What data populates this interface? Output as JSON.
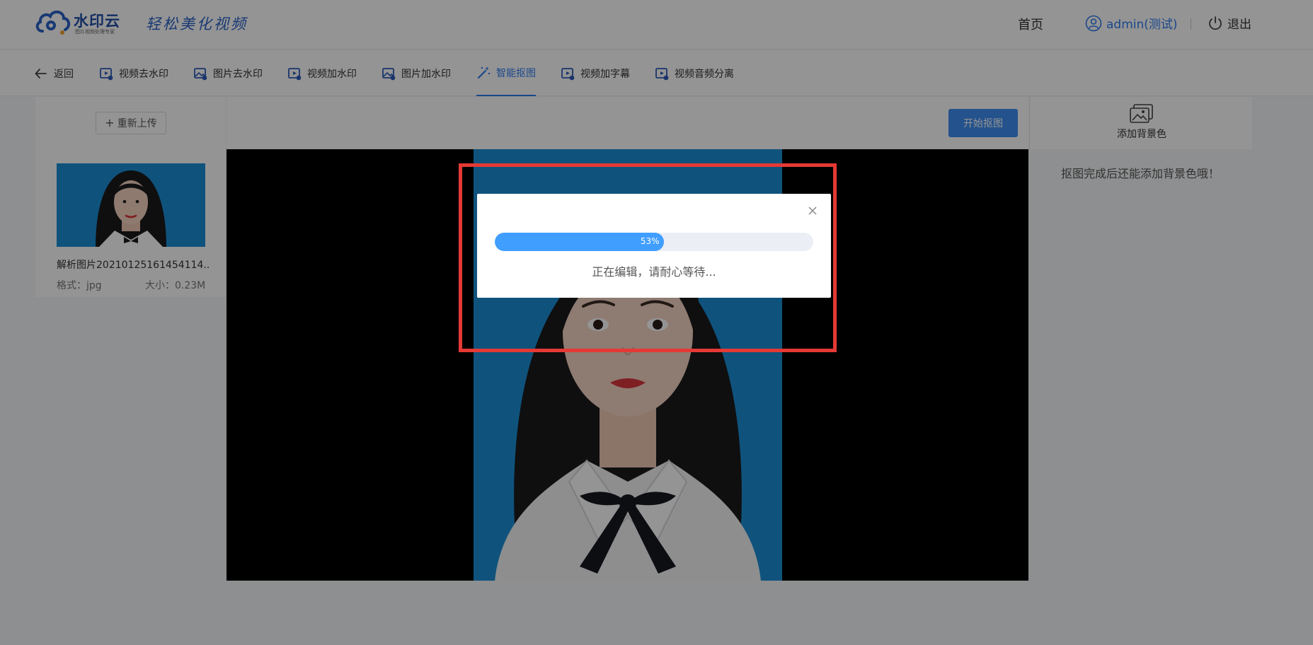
{
  "header": {
    "logo_name": "水印云",
    "logo_sub": "图片视频处理专家",
    "slogan": "轻松美化视频",
    "home": "首页",
    "user": "admin(测试)",
    "logout": "退出"
  },
  "toolbar": {
    "items": [
      {
        "label": "返回",
        "icon": "arrow-left-icon"
      },
      {
        "label": "视频去水印",
        "icon": "video-icon"
      },
      {
        "label": "图片去水印",
        "icon": "image-icon"
      },
      {
        "label": "视频加水印",
        "icon": "video-icon"
      },
      {
        "label": "图片加水印",
        "icon": "image-icon"
      },
      {
        "label": "智能抠图",
        "icon": "magic-wand-icon",
        "active": true
      },
      {
        "label": "视频加字幕",
        "icon": "video-icon"
      },
      {
        "label": "视频音频分离",
        "icon": "video-icon"
      }
    ]
  },
  "left": {
    "reupload": "重新上传",
    "file_name": "解析图片20210125161454114...",
    "format": "格式：jpg",
    "size": "大小：0.23M"
  },
  "canvas": {
    "start_label": "开始抠图"
  },
  "right": {
    "add_bg_label": "添加背景色",
    "tip": "抠图完成后还能添加背景色哦！"
  },
  "dialog": {
    "progress": 53,
    "progress_text": "53%",
    "message": "正在编辑，请耐心等待..."
  },
  "colors": {
    "accent": "#2e7bf0",
    "progress": "#409eff",
    "highlight": "#e53935",
    "photo_bg": "#1a8fd8"
  }
}
